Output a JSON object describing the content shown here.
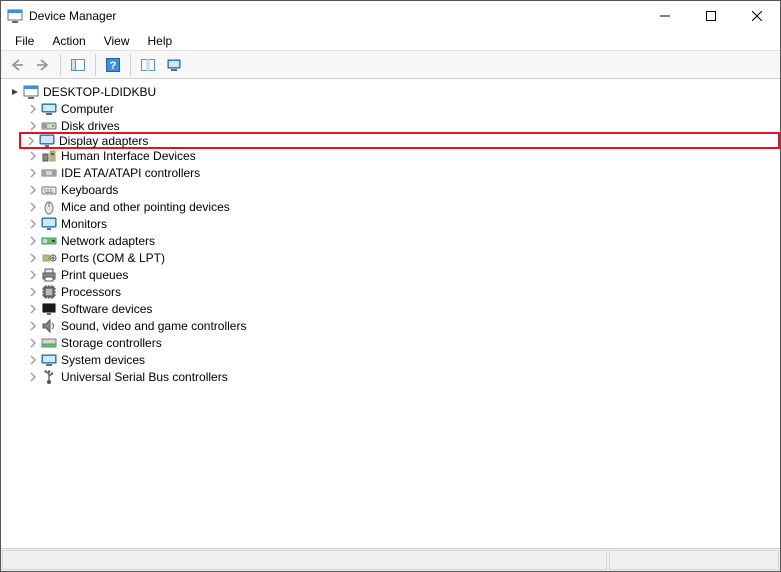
{
  "window": {
    "title": "Device Manager"
  },
  "menu": {
    "file": "File",
    "action": "Action",
    "view": "View",
    "help": "Help"
  },
  "tree": {
    "root": "DESKTOP-LDIDKBU",
    "items": [
      "Computer",
      "Disk drives",
      "Display adapters",
      "Human Interface Devices",
      "IDE ATA/ATAPI controllers",
      "Keyboards",
      "Mice and other pointing devices",
      "Monitors",
      "Network adapters",
      "Ports (COM & LPT)",
      "Print queues",
      "Processors",
      "Software devices",
      "Sound, video and game controllers",
      "Storage controllers",
      "System devices",
      "Universal Serial Bus controllers"
    ]
  }
}
